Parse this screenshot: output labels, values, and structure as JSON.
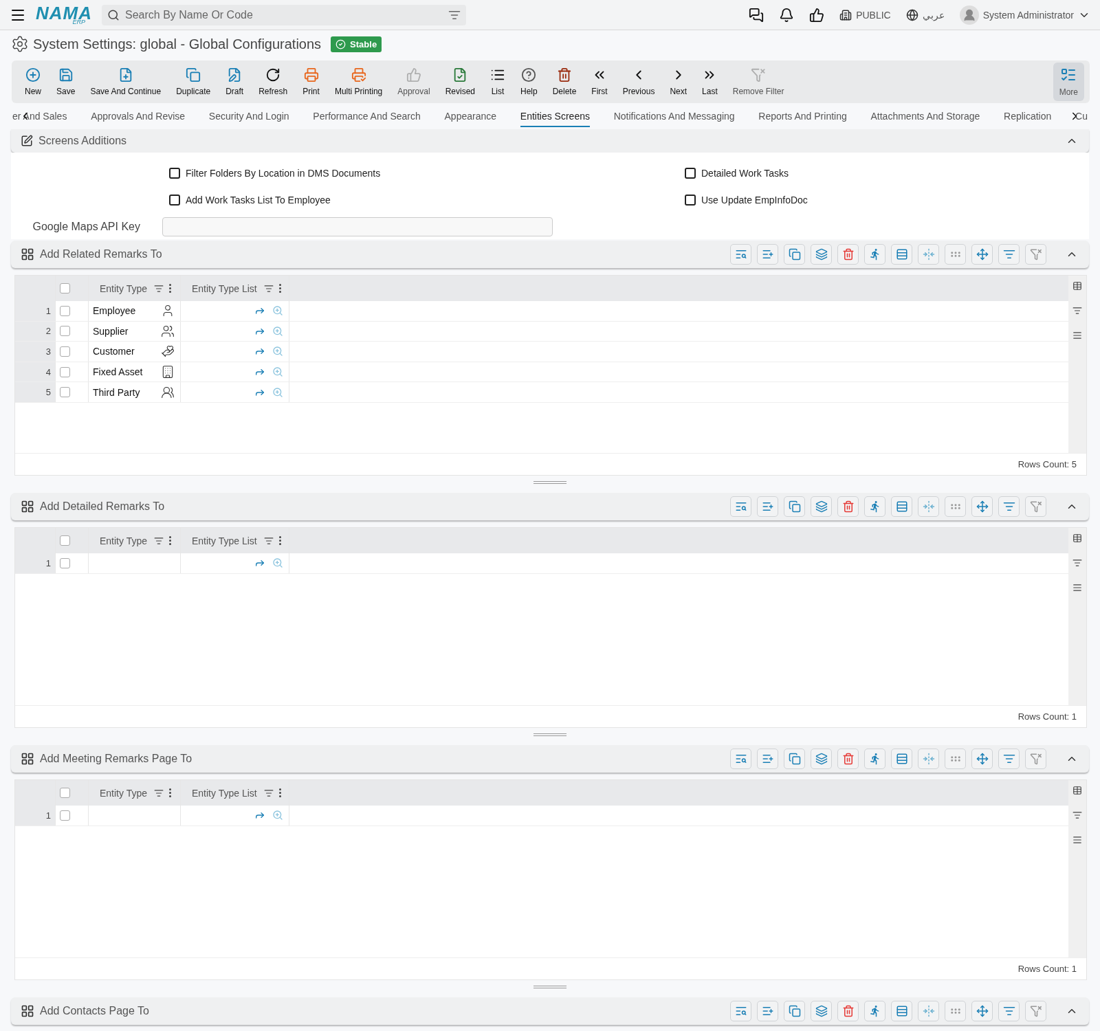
{
  "topbar": {
    "logo": "NAMA",
    "logo_sub": "ERP",
    "search": {
      "placeholder": "Search By Name Or Code"
    },
    "company": "PUBLIC",
    "language": "عربي",
    "user": "System Administrator"
  },
  "title": "System Settings: global - Global Configurations",
  "status": "Stable",
  "toolbar": [
    {
      "label": "New",
      "disabled": false
    },
    {
      "label": "Save",
      "disabled": false
    },
    {
      "label": "Save And Continue",
      "disabled": false
    },
    {
      "label": "Duplicate",
      "disabled": false
    },
    {
      "label": "Draft",
      "disabled": false
    },
    {
      "label": "Refresh",
      "disabled": false
    },
    {
      "label": "Print",
      "disabled": false
    },
    {
      "label": "Multi Printing",
      "disabled": false
    },
    {
      "label": "Approval",
      "disabled": true
    },
    {
      "label": "Revised",
      "disabled": false
    },
    {
      "label": "List",
      "disabled": false
    },
    {
      "label": "Help",
      "disabled": false
    },
    {
      "label": "Delete",
      "disabled": false
    },
    {
      "label": "First",
      "disabled": false
    },
    {
      "label": "Previous",
      "disabled": false
    },
    {
      "label": "Next",
      "disabled": false
    },
    {
      "label": "Last",
      "disabled": false
    },
    {
      "label": "Remove Filter",
      "disabled": true
    }
  ],
  "more": {
    "label": "More"
  },
  "tabs": [
    {
      "label": "er And Sales",
      "selected": false
    },
    {
      "label": "Approvals And Revise",
      "selected": false
    },
    {
      "label": "Security And Login",
      "selected": false
    },
    {
      "label": "Performance And Search",
      "selected": false
    },
    {
      "label": "Appearance",
      "selected": false
    },
    {
      "label": "Entities Screens",
      "selected": true
    },
    {
      "label": "Notifications And Messaging",
      "selected": false
    },
    {
      "label": "Reports And Printing",
      "selected": false
    },
    {
      "label": "Attachments And Storage",
      "selected": false
    },
    {
      "label": "Replication",
      "selected": false
    },
    {
      "label": "Cu",
      "selected": false
    }
  ],
  "screens_additions": {
    "title": "Screens Additions",
    "expanded": true,
    "checkboxes": [
      {
        "label": "Filter Folders By Location in DMS Documents",
        "checked": false
      },
      {
        "label": "Detailed Work Tasks",
        "checked": false
      },
      {
        "label": "Add Work Tasks List To Employee",
        "checked": false
      },
      {
        "label": "Use Update EmpInfoDoc",
        "checked": false
      }
    ],
    "field": {
      "label": "Google Maps API Key"
    }
  },
  "grids": [
    {
      "title": "Add Related Remarks To",
      "expanded": true,
      "select_all_checked": false,
      "columns": [
        "Entity Type",
        "Entity Type List"
      ],
      "rows_count": "Rows Count: 5",
      "rows": [
        {
          "number": "1",
          "entity_type": "Employee",
          "checked": false
        },
        {
          "number": "2",
          "entity_type": "Supplier",
          "checked": false
        },
        {
          "number": "3",
          "entity_type": "Customer",
          "checked": false
        },
        {
          "number": "4",
          "entity_type": "Fixed Asset",
          "checked": false
        },
        {
          "number": "5",
          "entity_type": "Third Party",
          "checked": false
        }
      ]
    },
    {
      "title": "Add Detailed Remarks To",
      "expanded": true,
      "select_all_checked": false,
      "columns": [
        "Entity Type",
        "Entity Type List"
      ],
      "rows_count": "Rows Count: 1",
      "rows": [
        {
          "number": "1",
          "checked": false
        }
      ]
    },
    {
      "title": "Add Meeting Remarks Page To",
      "expanded": true,
      "select_all_checked": false,
      "columns": [
        "Entity Type",
        "Entity Type List"
      ],
      "rows_count": "Rows Count: 1",
      "rows": [
        {
          "number": "1",
          "checked": false
        }
      ]
    },
    {
      "title": "Add Contacts Page To",
      "expanded": true
    }
  ]
}
